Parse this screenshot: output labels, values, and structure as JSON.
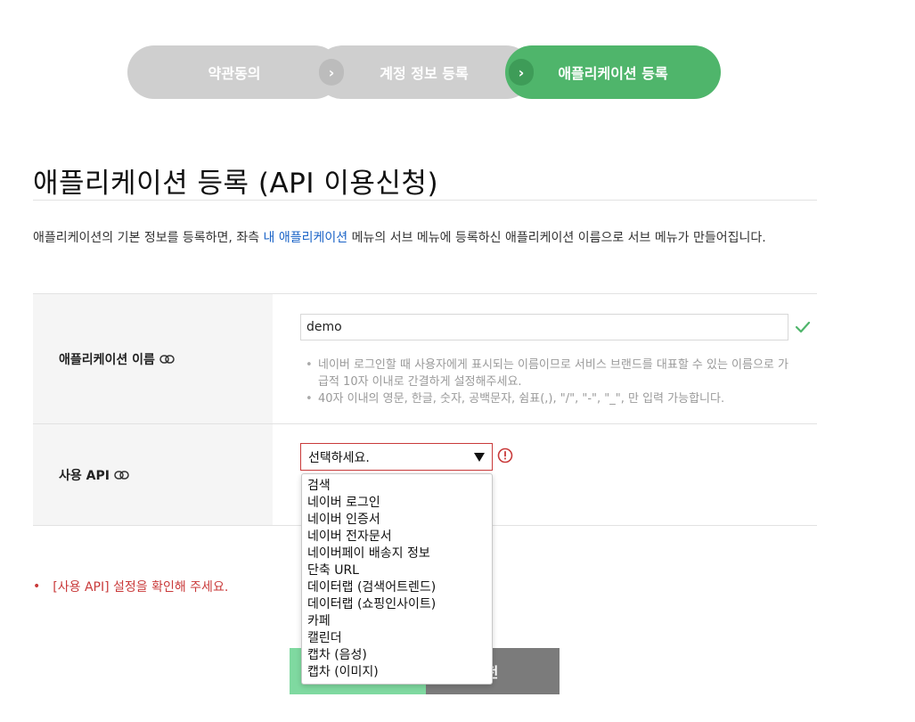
{
  "steps": {
    "step1": "약관동의",
    "step2": "계정 정보 등록",
    "step3": "애플리케이션 등록",
    "arrow": "›"
  },
  "page": {
    "title": "애플리케이션 등록 (API 이용신청)",
    "desc_before": "애플리케이션의 기본 정보를 등록하면, 좌측 ",
    "desc_link": "내 애플리케이션",
    "desc_after": " 메뉴의 서브 메뉴에 등록하신 애플리케이션 이름으로 서브 메뉴가 만들어집니다."
  },
  "form": {
    "app_name_label": "애플리케이션 이름",
    "app_name_value": "demo",
    "hint1": "네이버 로그인할 때 사용자에게 표시되는 이름이므로 서비스 브랜드를 대표할 수 있는 이름으로 가급적 10자 이내로 간결하게 설정해주세요.",
    "hint2": "40자 이내의 영문, 한글, 숫자, 공백문자, 쉼표(,), \"/\", \"-\", \"_\", 만 입력 가능합니다.",
    "api_label": "사용 API",
    "api_select_value": "선택하세요."
  },
  "dropdown_options": [
    "검색",
    "네이버 로그인",
    "네이버 인증서",
    "네이버 전자문서",
    "네이버페이 배송지 정보",
    "단축 URL",
    "데이터랩 (검색어트렌드)",
    "데이터랩 (쇼핑인사이트)",
    "카페",
    "캘린더",
    "캡차 (음성)",
    "캡차 (이미지)"
  ],
  "error": {
    "bullet": "•",
    "message": "[사용 API] 설정을 확인해 주세요."
  },
  "buttons": {
    "right_label": "전"
  },
  "colors": {
    "accent_green": "#4fb56b",
    "error_red": "#c93a3a",
    "link_blue": "#1a63c7"
  }
}
